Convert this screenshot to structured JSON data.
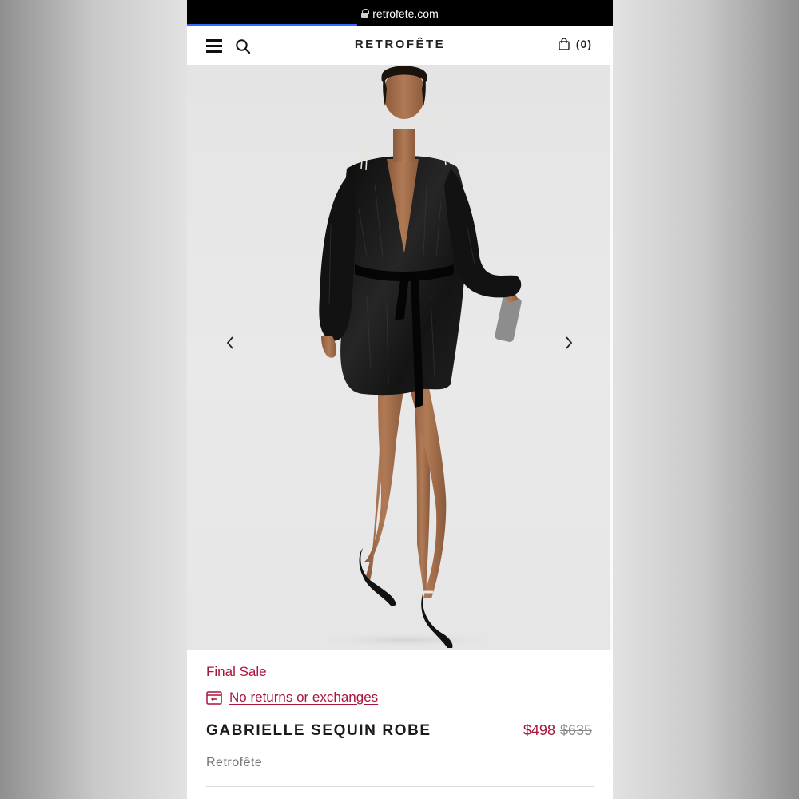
{
  "browser": {
    "url": "retrofete.com"
  },
  "header": {
    "logo": "RETROFÊTE",
    "cart_count": "(0)"
  },
  "gallery": {
    "image_index": 1
  },
  "product": {
    "sale_label": "Final Sale",
    "returns_link": "No returns or exchanges",
    "name": "GABRIELLE SEQUIN ROBE",
    "price_sale": "$498",
    "price_original": "$635",
    "brand": "Retrofête"
  },
  "colors": {
    "accent": "#a8153a",
    "progress": "#2f6bff"
  }
}
